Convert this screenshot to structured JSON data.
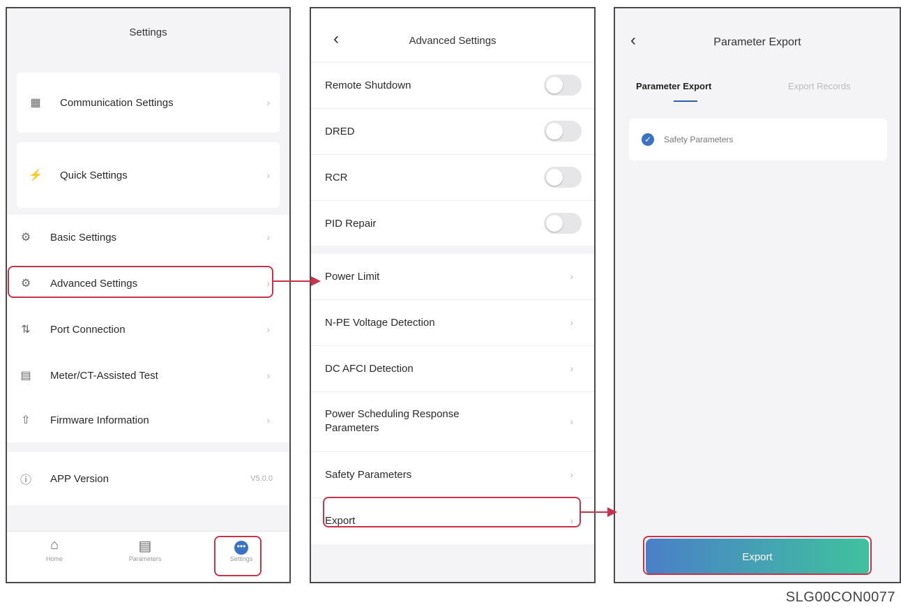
{
  "screen1": {
    "title": "Settings",
    "items": [
      {
        "label": "Communication Settings",
        "icon": "network-icon"
      },
      {
        "label": "Quick Settings",
        "icon": "lightning-icon"
      },
      {
        "label": "Basic Settings",
        "icon": "gear-icon"
      },
      {
        "label": "Advanced Settings",
        "icon": "advanced-settings-icon"
      },
      {
        "label": "Port Connection",
        "icon": "port-icon"
      },
      {
        "label": "Meter/CT-Assisted Test",
        "icon": "meter-icon"
      },
      {
        "label": "Firmware Information",
        "icon": "firmware-icon"
      },
      {
        "label": "APP Version",
        "icon": "info-icon",
        "value": "V5.0.0"
      }
    ],
    "tabs": [
      {
        "label": "Home",
        "icon": "home-icon"
      },
      {
        "label": "Parameters",
        "icon": "document-icon"
      },
      {
        "label": "Settings",
        "icon": "settings-dots-icon"
      }
    ]
  },
  "screen2": {
    "title": "Advanced Settings",
    "toggles": [
      {
        "label": "Remote Shutdown"
      },
      {
        "label": "DRED"
      },
      {
        "label": "RCR"
      },
      {
        "label": "PID Repair"
      }
    ],
    "items": [
      {
        "label": "Power Limit"
      },
      {
        "label": "N-PE Voltage Detection"
      },
      {
        "label": "DC AFCI Detection"
      },
      {
        "label": "Power Scheduling Response Parameters"
      },
      {
        "label": "Safety Parameters"
      },
      {
        "label": "Export"
      }
    ]
  },
  "screen3": {
    "title": "Parameter Export",
    "tabs": [
      "Parameter Export",
      "Export Records"
    ],
    "option": "Safety Parameters",
    "button": "Export"
  },
  "caption": "SLG00CON0077",
  "colors": {
    "highlight": "#c8334a",
    "button_from": "#4a7fc8",
    "button_to": "#3fc29e",
    "check": "#3a72c4"
  }
}
